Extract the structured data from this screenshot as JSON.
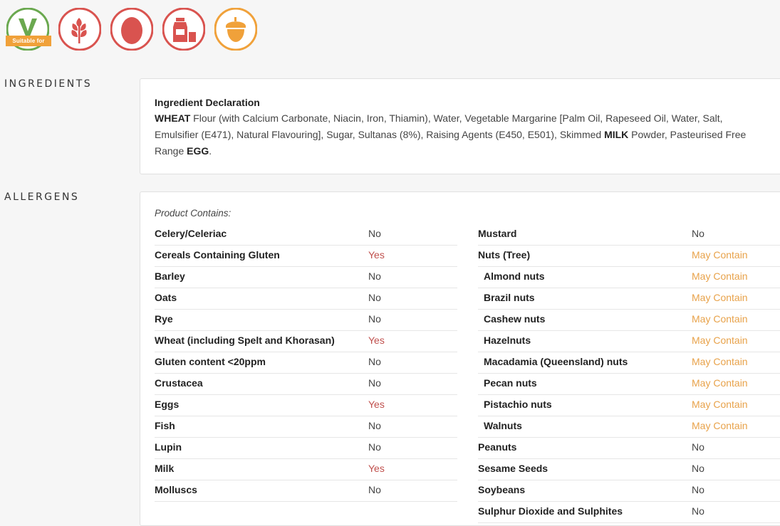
{
  "badges": {
    "vegetarian_text": "Suitable for",
    "icons": [
      "vegetarian-icon",
      "gluten-wheat-icon",
      "egg-icon",
      "milk-icon",
      "nuts-icon"
    ]
  },
  "colors": {
    "red": "#d9534f",
    "orange": "#f0a13a",
    "green": "#6aa84f",
    "yes": "#c0504d",
    "may": "#e8a24a"
  },
  "ingredients": {
    "section_label": "INGREDIENTS",
    "heading": "Ingredient Declaration",
    "parts": [
      {
        "b": "WHEAT",
        "t": " Flour (with Calcium Carbonate, Niacin, Iron, Thiamin), Water, Vegetable Margarine [Palm Oil, Rapeseed Oil, Water, Salt, Emulsifier (E471), Natural Flavouring], Sugar, Sultanas (8%), Raising Agents (E450, E501), Skimmed "
      },
      {
        "b": "MILK",
        "t": " Powder, Pasteurised Free Range "
      },
      {
        "b": "EGG",
        "t": "."
      }
    ]
  },
  "allergens": {
    "section_label": "ALLERGENS",
    "contains_label": "Product Contains:",
    "left": [
      {
        "name": "Celery/Celeriac",
        "value": "No",
        "status": "no"
      },
      {
        "name": "Cereals Containing Gluten",
        "value": "Yes",
        "status": "yes"
      },
      {
        "name": "Barley",
        "value": "No",
        "status": "no"
      },
      {
        "name": "Oats",
        "value": "No",
        "status": "no"
      },
      {
        "name": "Rye",
        "value": "No",
        "status": "no"
      },
      {
        "name": "Wheat (including Spelt and Khorasan)",
        "value": "Yes",
        "status": "yes"
      },
      {
        "name": "Gluten content <20ppm",
        "value": "No",
        "status": "no"
      },
      {
        "name": "Crustacea",
        "value": "No",
        "status": "no"
      },
      {
        "name": "Eggs",
        "value": "Yes",
        "status": "yes"
      },
      {
        "name": "Fish",
        "value": "No",
        "status": "no"
      },
      {
        "name": "Lupin",
        "value": "No",
        "status": "no"
      },
      {
        "name": "Milk",
        "value": "Yes",
        "status": "yes"
      },
      {
        "name": "Molluscs",
        "value": "No",
        "status": "no"
      }
    ],
    "right": [
      {
        "name": "Mustard",
        "value": "No",
        "status": "no"
      },
      {
        "name": "Nuts (Tree)",
        "value": "May Contain",
        "status": "may"
      },
      {
        "name": "Almond nuts",
        "value": "May Contain",
        "status": "may",
        "sub": true
      },
      {
        "name": "Brazil nuts",
        "value": "May Contain",
        "status": "may",
        "sub": true
      },
      {
        "name": "Cashew nuts",
        "value": "May Contain",
        "status": "may",
        "sub": true
      },
      {
        "name": "Hazelnuts",
        "value": "May Contain",
        "status": "may",
        "sub": true
      },
      {
        "name": "Macadamia (Queensland) nuts",
        "value": "May Contain",
        "status": "may",
        "sub": true
      },
      {
        "name": "Pecan nuts",
        "value": "May Contain",
        "status": "may",
        "sub": true
      },
      {
        "name": "Pistachio nuts",
        "value": "May Contain",
        "status": "may",
        "sub": true
      },
      {
        "name": "Walnuts",
        "value": "May Contain",
        "status": "may",
        "sub": true
      },
      {
        "name": "Peanuts",
        "value": "No",
        "status": "no"
      },
      {
        "name": "Sesame Seeds",
        "value": "No",
        "status": "no"
      },
      {
        "name": "Soybeans",
        "value": "No",
        "status": "no"
      },
      {
        "name": "Sulphur Dioxide and Sulphites",
        "value": "No",
        "status": "no"
      }
    ]
  }
}
